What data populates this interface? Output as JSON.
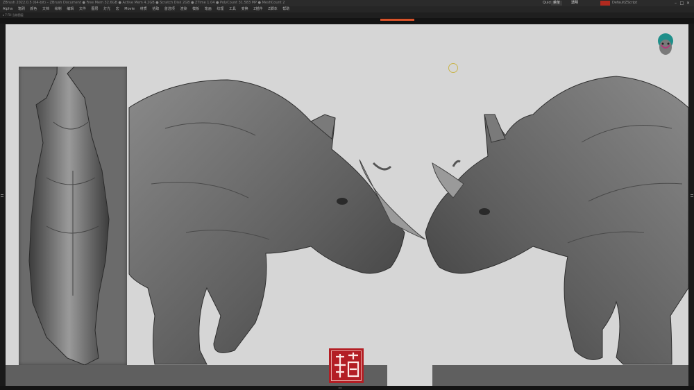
{
  "titlebar": {
    "title": "ZBrush 2022.0.5 (64-bit) – ZBrush Document  ● Free Mem 32.6GB ● Active Mem 4.2GB ● Scratch Disk 2GB ● ZTime 1.04 ● PolyCount 31.583 MP ● MeshCount 2",
    "quicksave_label": "QuickSave",
    "menus_label": "菜单",
    "ui_label": "透明",
    "default_label": "DefaultZScript"
  },
  "menubar": {
    "items": [
      "Alpha",
      "笔刷",
      "颜色",
      "文档",
      "绘制",
      "编辑",
      "文件",
      "图层",
      "灯光",
      "宏",
      "Movie",
      "材质",
      "拾取",
      "首选项",
      "渲染",
      "模板",
      "笔画",
      "纹理",
      "工具",
      "变换",
      "Z插件",
      "Z脚本",
      "帮助"
    ]
  },
  "statusline": {
    "text": "▸ 7 Fill 当前图层"
  },
  "seal": {
    "chars": "豪杰"
  },
  "bottombar": {
    "marker": "◂ ▸"
  },
  "colors": {
    "accent": "#d9532a",
    "seal": "#b31e24",
    "viewport_bg": "#d6d6d6"
  }
}
